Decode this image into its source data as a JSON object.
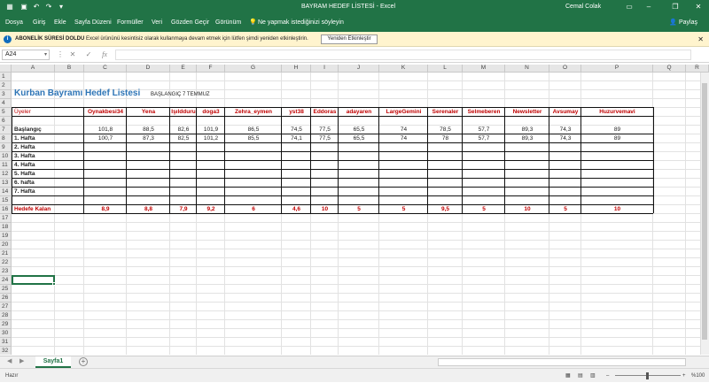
{
  "window": {
    "title": "BAYRAM HEDEF LİSTESİ  -  Excel",
    "user": "Cemal Colak",
    "share": "Paylaş"
  },
  "ribbon_tabs": [
    "Dosya",
    "Giriş",
    "Ekle",
    "Sayfa Düzeni",
    "Formüller",
    "Veri",
    "Gözden Geçir",
    "Görünüm"
  ],
  "tell_me": "Ne yapmak istediğinizi söyleyin",
  "message_bar": {
    "label": "ABONELİK SÜRESİ DOLDU",
    "text": "Excel ürününü kesintisiz olarak kullanmaya devam etmek için lütfen şimdi yeniden etkinleştirin.",
    "button": "Yeniden Etkinleştir"
  },
  "formula_bar": {
    "name_box": "A24",
    "fx": "fx",
    "value": ""
  },
  "columns": [
    "A",
    "B",
    "C",
    "D",
    "E",
    "F",
    "G",
    "H",
    "I",
    "J",
    "K",
    "L",
    "M",
    "N",
    "O",
    "P",
    "Q",
    "R"
  ],
  "rows": [
    "1",
    "2",
    "3",
    "4",
    "5",
    "6",
    "7",
    "8",
    "9",
    "10",
    "11",
    "12",
    "13",
    "14",
    "15",
    "16",
    "17",
    "18",
    "19",
    "20",
    "21",
    "22",
    "23",
    "24",
    "25",
    "26",
    "27",
    "28",
    "29",
    "30",
    "31",
    "32",
    "33"
  ],
  "sheet": {
    "title": "Kurban Bayramı Hedef Listesi",
    "start": "BAŞLANGIÇ 7 TEMMUZ",
    "header_row_label": "Üyeler",
    "members": [
      "Oynakbesi34",
      "Yena",
      "Işıldduru",
      "doga3",
      "Zehra_eymen",
      "yst38",
      "Eddoras",
      "adayaren",
      "LargeGemini",
      "Serenaler",
      "Selmeberen",
      "Newsletter",
      "Avsumay",
      "Huzurvemavi"
    ],
    "row_labels": [
      "Başlangıç",
      "1. Hafta",
      "2. Hafta",
      "3. Hafta",
      "4. Hafta",
      "5. Hafta",
      "6. hafta",
      "7. Hafta"
    ],
    "baslangic": [
      "101,8",
      "88,5",
      "82,6",
      "101,9",
      "86,5",
      "74,5",
      "77,5",
      "65,5",
      "74",
      "78,5",
      "57,7",
      "89,3",
      "74,3",
      "89"
    ],
    "hafta1": [
      "100,7",
      "87,3",
      "82,5",
      "101,2",
      "85,5",
      "74,1",
      "77,5",
      "65,5",
      "74",
      "78",
      "57,7",
      "89,3",
      "74,3",
      "89"
    ],
    "hedef_label": "Hedefe Kalan",
    "hedef": [
      "8,9",
      "8,8",
      "7,9",
      "9,2",
      "6",
      "4,6",
      "10",
      "5",
      "5",
      "9,5",
      "5",
      "10",
      "5",
      "10"
    ]
  },
  "sheet_tabs": [
    "Sayfa1"
  ],
  "status": {
    "ready": "Hazır",
    "zoom": "%100"
  },
  "colors": {
    "excel_green": "#217346",
    "title_blue": "#2e75b6",
    "red_text": "#c00000",
    "msg_bg": "#fff4ce"
  }
}
